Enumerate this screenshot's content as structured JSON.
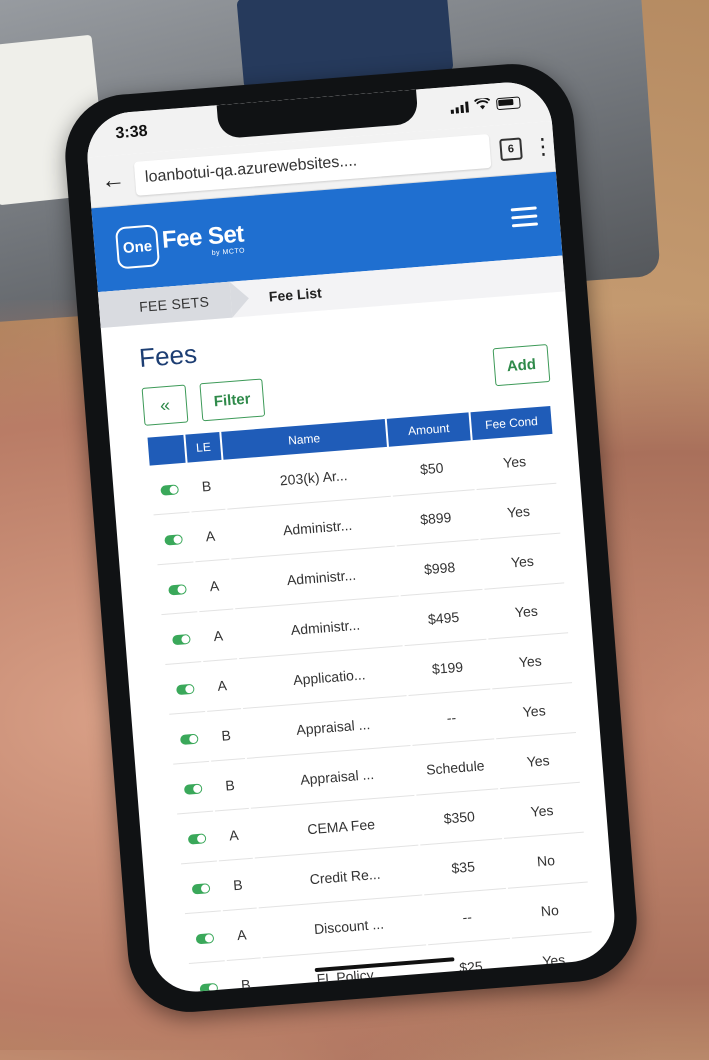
{
  "status_bar": {
    "time": "3:38"
  },
  "browser": {
    "url": "loanbotui-qa.azurewebsites....",
    "tab_count": "6"
  },
  "app": {
    "logo_one": "One",
    "logo_name": "Fee Set",
    "logo_sub": "by MCTO"
  },
  "breadcrumb": {
    "parent": "FEE SETS",
    "current": "Fee List"
  },
  "page": {
    "title": "Fees"
  },
  "toolbar": {
    "collapse_label": "«",
    "filter_label": "Filter",
    "add_label": "Add"
  },
  "table": {
    "headers": [
      "",
      "LE",
      "Name",
      "Amount",
      "Fee Cond"
    ],
    "rows": [
      {
        "le": "B",
        "name": "203(k) Ar...",
        "amount": "$50",
        "fee_cond": "Yes"
      },
      {
        "le": "A",
        "name": "Administr...",
        "amount": "$899",
        "fee_cond": "Yes"
      },
      {
        "le": "A",
        "name": "Administr...",
        "amount": "$998",
        "fee_cond": "Yes"
      },
      {
        "le": "A",
        "name": "Administr...",
        "amount": "$495",
        "fee_cond": "Yes"
      },
      {
        "le": "A",
        "name": "Applicatio...",
        "amount": "$199",
        "fee_cond": "Yes"
      },
      {
        "le": "B",
        "name": "Appraisal ...",
        "amount": "--",
        "fee_cond": "Yes"
      },
      {
        "le": "B",
        "name": "Appraisal ...",
        "amount": "Schedule",
        "fee_cond": "Yes"
      },
      {
        "le": "A",
        "name": "CEMA Fee",
        "amount": "$350",
        "fee_cond": "Yes"
      },
      {
        "le": "B",
        "name": "Credit Re...",
        "amount": "$35",
        "fee_cond": "No"
      },
      {
        "le": "A",
        "name": "Discount ...",
        "amount": "--",
        "fee_cond": "No"
      },
      {
        "le": "B",
        "name": "FL Policy ...",
        "amount": "$25",
        "fee_cond": "Yes"
      }
    ]
  },
  "colors": {
    "brand_blue": "#1f6fd0",
    "header_blue": "#1f5cb8",
    "accent_green": "#3aa85a"
  }
}
